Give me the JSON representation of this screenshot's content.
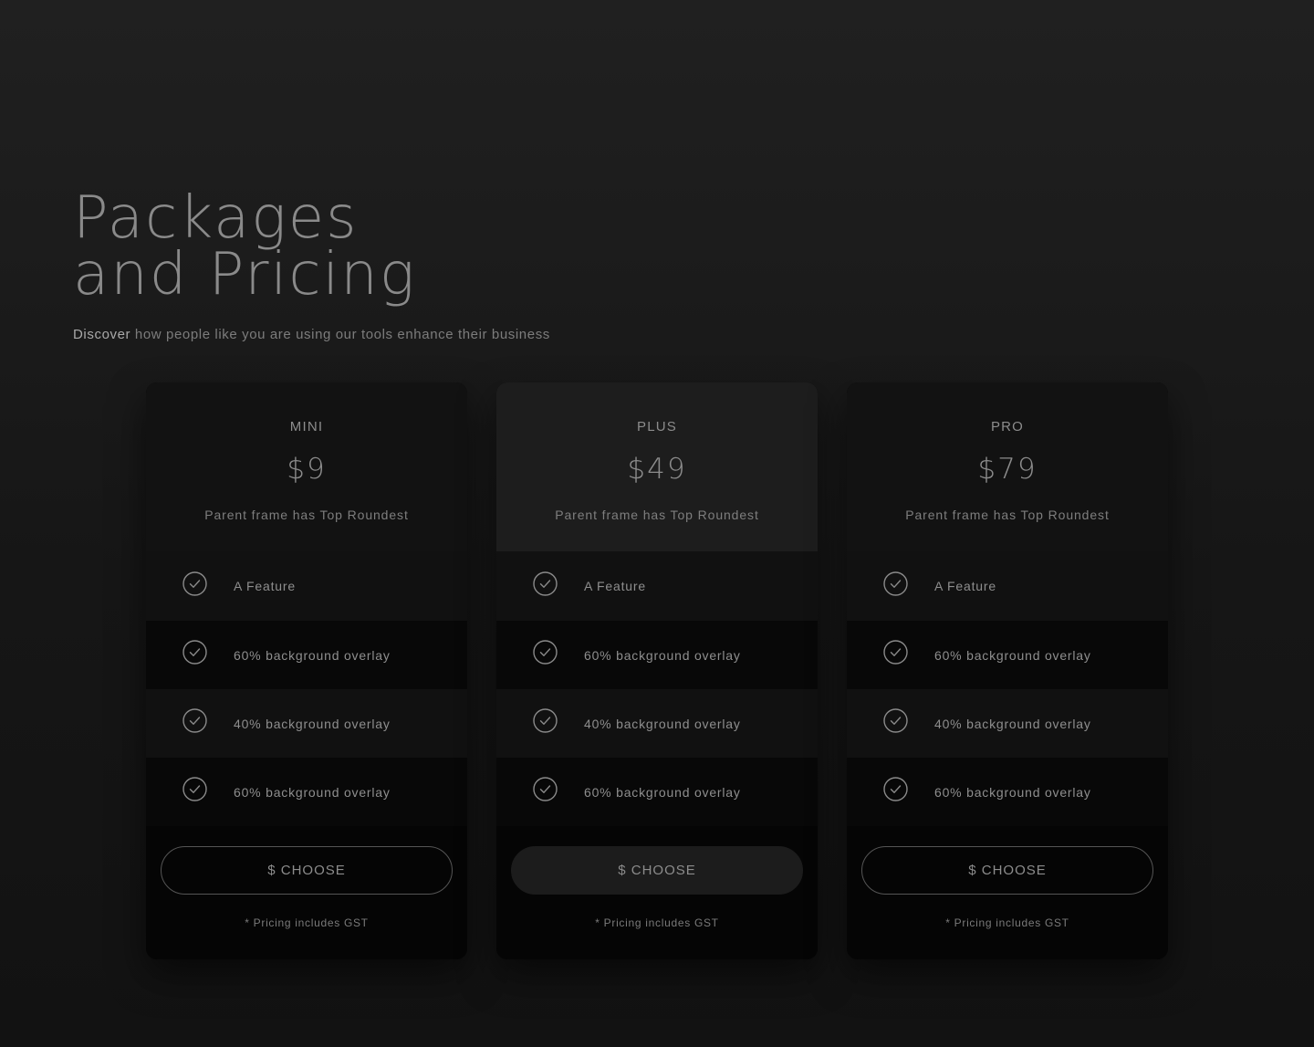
{
  "hero": {
    "title_line1": "Packages",
    "title_line2": "and Pricing",
    "subtitle_strong": "Discover",
    "subtitle_rest": " how people like you are using our tools enhance their business"
  },
  "plans": [
    {
      "name": "MINI",
      "price": "$9",
      "description": "Parent frame has Top Roundest",
      "features": [
        "A Feature",
        "60% background overlay",
        "40% background overlay",
        "60% background overlay"
      ],
      "cta": "$ CHOOSE",
      "note": "* Pricing includes GST"
    },
    {
      "name": "PLUS",
      "price": "$49",
      "description": "Parent frame has Top Roundest",
      "features": [
        "A Feature",
        "60% background overlay",
        "40% background overlay",
        "60% background overlay"
      ],
      "cta": "$ CHOOSE",
      "note": "* Pricing includes GST"
    },
    {
      "name": "PRO",
      "price": "$79",
      "description": "Parent frame has Top Roundest",
      "features": [
        "A Feature",
        "60% background overlay",
        "40% background overlay",
        "60% background overlay"
      ],
      "cta": "$ CHOOSE",
      "note": "* Pricing includes GST"
    }
  ],
  "icons": {
    "feature": "check-circle-icon"
  },
  "colors": {
    "background": "#1a1a1a",
    "card": "#050505",
    "card_head": "#121212",
    "card_head_featured": "#1d1d1d",
    "text_muted": "#8c8c8c",
    "button_border": "#555555"
  }
}
